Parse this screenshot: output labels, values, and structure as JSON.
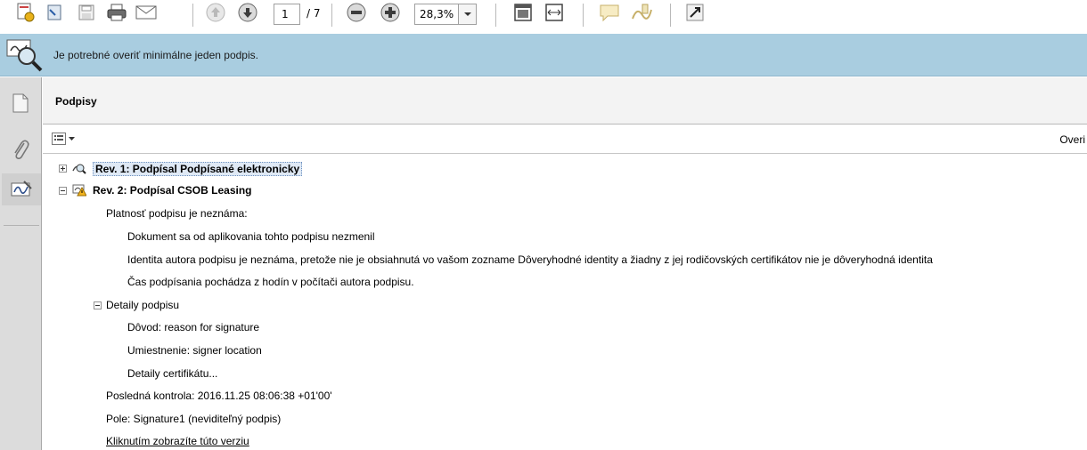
{
  "toolbar": {
    "current_page": "1",
    "page_total": "/ 7",
    "zoom": "28,3%",
    "icons": [
      "create-icon",
      "attach-icon",
      "save-icon",
      "print-icon",
      "email-icon",
      "previous-page-icon",
      "next-page-icon",
      "zoom-out-icon",
      "zoom-in-icon",
      "fit-page-icon",
      "fit-width-icon",
      "comment-icon",
      "sign-icon",
      "expand-icon"
    ]
  },
  "message_bar": {
    "text": "Je potrebné overiť minimálne jeden podpis.",
    "icon": "signature-validate-icon"
  },
  "rail": {
    "items": [
      "pages-icon",
      "attachments-icon",
      "signatures-icon"
    ]
  },
  "panel": {
    "title": "Podpisy",
    "verify_label": "Overi",
    "options_icon": "options-icon"
  },
  "tree": {
    "rev1": "Rev. 1: Podpísal Podpísané elektronicky",
    "rev2": "Rev. 2: Podpísal CSOB Leasing",
    "validity": "Platnosť podpisu je neznáma:",
    "doc_unchanged": "Dokument sa od aplikovania tohto podpisu nezmenil",
    "identity_unknown": "Identita autora podpisu je neznáma, pretože nie je obsiahnutá vo vašom zozname Dôveryhodné identity a žiadny z jej rodičovských certifikátov nie je dôveryhodná identita",
    "time_source": "Čas podpísania pochádza z hodín v počítači autora podpisu.",
    "details": "Detaily podpisu",
    "reason": "Dôvod: reason for signature",
    "location": "Umiestnenie: signer location",
    "cert_details": "Detaily certifikátu...",
    "last_check": "Posledná kontrola: 2016.11.25 08:06:38 +01'00'",
    "field": "Pole: Signature1 (neviditeľný podpis)",
    "view_version": "Kliknutím zobrazíte túto verziu"
  }
}
